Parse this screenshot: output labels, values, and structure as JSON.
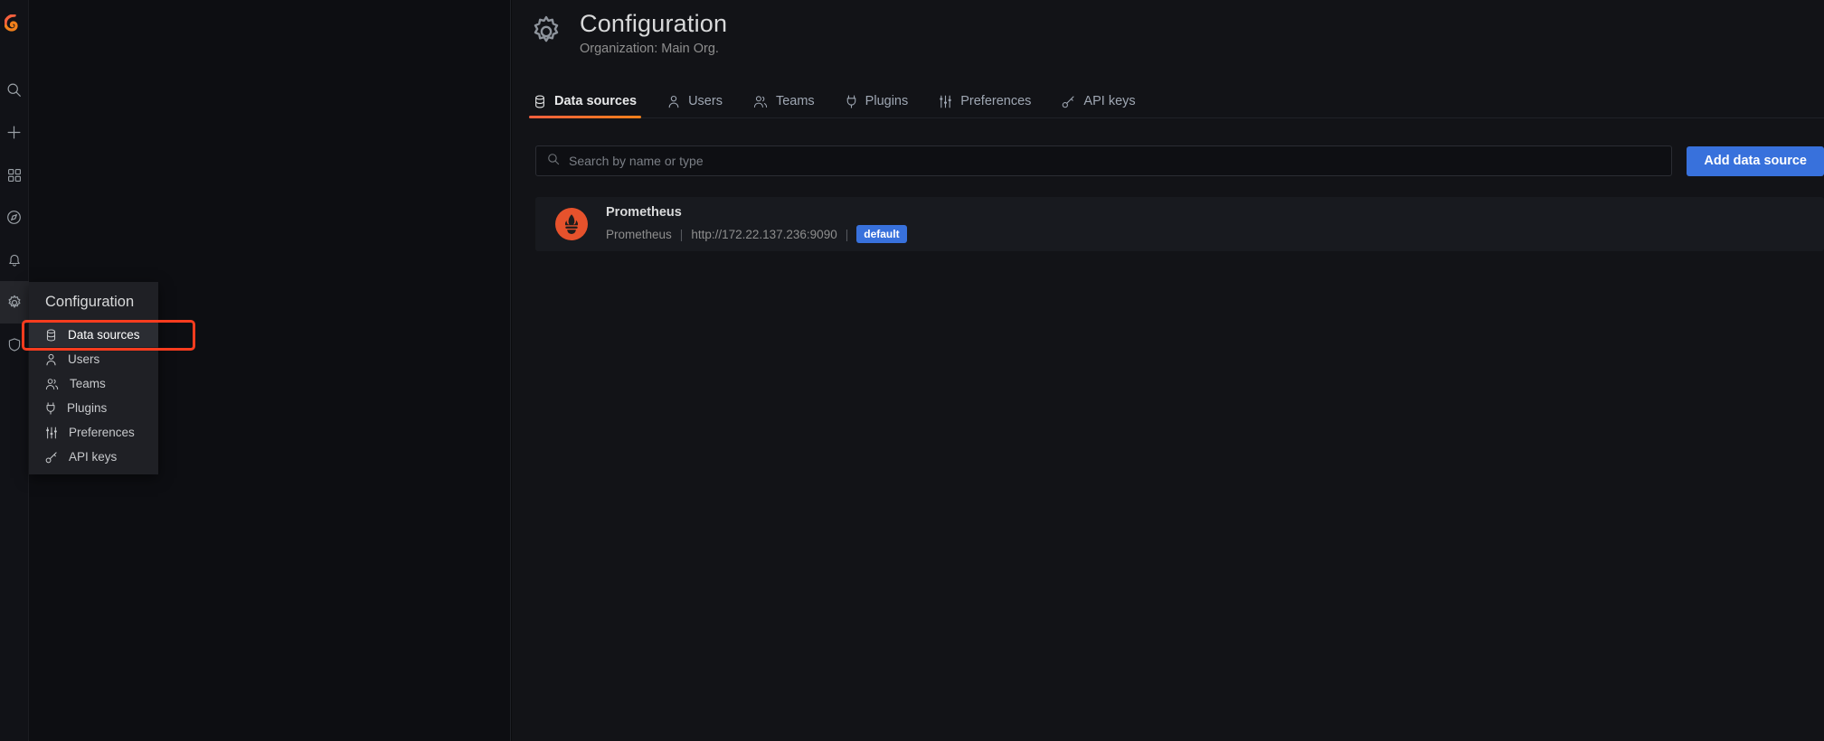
{
  "colors": {
    "accent_blue": "#3871dc",
    "accent_orange": "#f55f3e",
    "highlight_red": "#f93c1e",
    "prometheus_orange": "#e6522c",
    "page_bg": "#121317",
    "panel_bg": "#181a1f",
    "menu_bg": "#1f2025"
  },
  "navrail": {
    "items": [
      {
        "name": "grafana-logo-icon",
        "label": "Grafana"
      },
      {
        "name": "search-icon",
        "label": "Search"
      },
      {
        "name": "plus-icon",
        "label": "Create"
      },
      {
        "name": "dashboards-icon",
        "label": "Dashboards"
      },
      {
        "name": "explore-icon",
        "label": "Explore"
      },
      {
        "name": "alerting-icon",
        "label": "Alerting"
      },
      {
        "name": "gear-icon",
        "label": "Configuration"
      },
      {
        "name": "shield-icon",
        "label": "Server Admin"
      }
    ]
  },
  "menu": {
    "title": "Configuration",
    "items": [
      {
        "label": "Data sources",
        "icon": "database-icon",
        "active": true
      },
      {
        "label": "Users",
        "icon": "user-icon",
        "active": false
      },
      {
        "label": "Teams",
        "icon": "users-icon",
        "active": false
      },
      {
        "label": "Plugins",
        "icon": "plug-icon",
        "active": false
      },
      {
        "label": "Preferences",
        "icon": "sliders-icon",
        "active": false
      },
      {
        "label": "API keys",
        "icon": "key-icon",
        "active": false
      }
    ]
  },
  "header": {
    "icon": "gear-icon",
    "title": "Configuration",
    "subtitle": "Organization: Main Org."
  },
  "tabs": [
    {
      "label": "Data sources",
      "icon": "database-icon",
      "active": true
    },
    {
      "label": "Users",
      "icon": "user-icon",
      "active": false
    },
    {
      "label": "Teams",
      "icon": "users-icon",
      "active": false
    },
    {
      "label": "Plugins",
      "icon": "plug-icon",
      "active": false
    },
    {
      "label": "Preferences",
      "icon": "sliders-icon",
      "active": false
    },
    {
      "label": "API keys",
      "icon": "key-icon",
      "active": false
    }
  ],
  "search": {
    "placeholder": "Search by name or type",
    "value": "",
    "icon": "search-icon"
  },
  "add_button": {
    "label": "Add data source"
  },
  "datasources": [
    {
      "name": "Prometheus",
      "type": "Prometheus",
      "url": "http://172.22.137.236:9090",
      "badge": "default",
      "logo": "prometheus-logo-icon",
      "separator": "|"
    }
  ]
}
